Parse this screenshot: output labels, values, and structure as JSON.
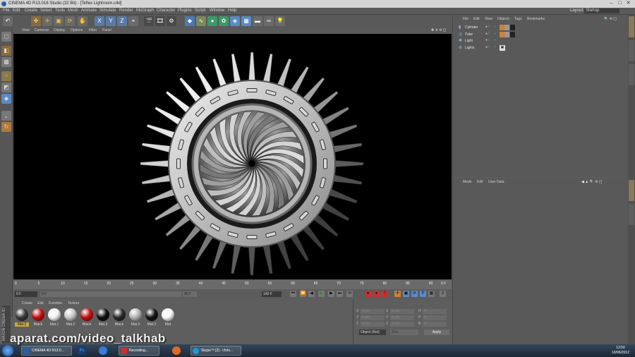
{
  "window": {
    "title": "CINEMA 4D R13.016 Studio (32 Bit) - [Teflex Lightroom.c4d]",
    "layout_label": "Layout:",
    "layout_value": "Startup"
  },
  "menubar": [
    "File",
    "Edit",
    "Create",
    "Select",
    "Tools",
    "Mesh",
    "Animate",
    "Simulate",
    "Render",
    "MoGraph",
    "Character",
    "Plugins",
    "Script",
    "Window",
    "Help"
  ],
  "viewport_menu": [
    "View",
    "Cameras",
    "Display",
    "Options",
    "Filter",
    "Panel"
  ],
  "toolbar_axis_labels": [
    "X",
    "Y",
    "Z"
  ],
  "timeline": {
    "ticks": [
      "0",
      "5",
      "10",
      "15",
      "20",
      "25",
      "30",
      "35",
      "40",
      "45",
      "50",
      "55",
      "60",
      "65",
      "70",
      "75",
      "80",
      "85",
      "90"
    ],
    "end_label": "0 F",
    "current_frame": "0 F",
    "start_field": "0 F",
    "end_field": "90 F",
    "max_field": "140 F"
  },
  "material_manager": {
    "menu": [
      "Create",
      "Edit",
      "Function",
      "Texture"
    ],
    "materials": [
      {
        "name": "Mat.2",
        "color": "#3a3a3a",
        "selected": true
      },
      {
        "name": "Black",
        "color": "#c41010",
        "selected": false
      },
      {
        "name": "Mat.1",
        "color": "#f2f2f2",
        "selected": false
      },
      {
        "name": "Mat.2",
        "color": "#c8c8c8",
        "selected": false
      },
      {
        "name": "Black",
        "color": "#c41010",
        "selected": false
      },
      {
        "name": "Mat.3",
        "color": "#111111",
        "selected": false
      },
      {
        "name": "Black",
        "color": "#2a2a2a",
        "selected": false
      },
      {
        "name": "Mat.3",
        "color": "#b4b4b4",
        "selected": false
      },
      {
        "name": "Mat.2",
        "color": "#151515",
        "selected": false
      },
      {
        "name": "Mat",
        "color": "#f8f8f8",
        "selected": false
      }
    ]
  },
  "coordinates": {
    "rows": [
      {
        "axis1": "X",
        "v1": "0 cm",
        "axis2": "X",
        "v2": "0 cm",
        "axis3": "H",
        "v3": "0°"
      },
      {
        "axis1": "Y",
        "v1": "0 cm",
        "axis2": "Y",
        "v2": "0 cm",
        "axis3": "P",
        "v3": "0°"
      },
      {
        "axis1": "Z",
        "v1": "0 cm",
        "axis2": "Z",
        "v2": "0 cm",
        "axis3": "B",
        "v3": "0°"
      }
    ],
    "mode_select": "Object (Rel)",
    "size_select": "Size",
    "apply_button": "Apply"
  },
  "object_manager": {
    "menu": [
      "File",
      "Edit",
      "View",
      "Objects",
      "Tags",
      "Bookmarks"
    ],
    "objects": [
      {
        "name": "Cylinder",
        "icon": "cylinder-icon"
      },
      {
        "name": "Tube",
        "icon": "tube-icon"
      },
      {
        "name": "Light",
        "icon": "light-icon"
      },
      {
        "name": "Lights",
        "icon": "null-icon"
      }
    ]
  },
  "attribute_manager": {
    "menu": [
      "Mode",
      "Edit",
      "User Data"
    ]
  },
  "taskbar": {
    "tasks": [
      "CINEMA 4D R13.0...",
      "Recording...",
      "Skype™ [2] - chris..."
    ],
    "time": "13:50",
    "date": "10/06/2012"
  },
  "watermark": "aparat.com/video_talkhab",
  "brand_vertical": "MAXON CINEMA 4D"
}
